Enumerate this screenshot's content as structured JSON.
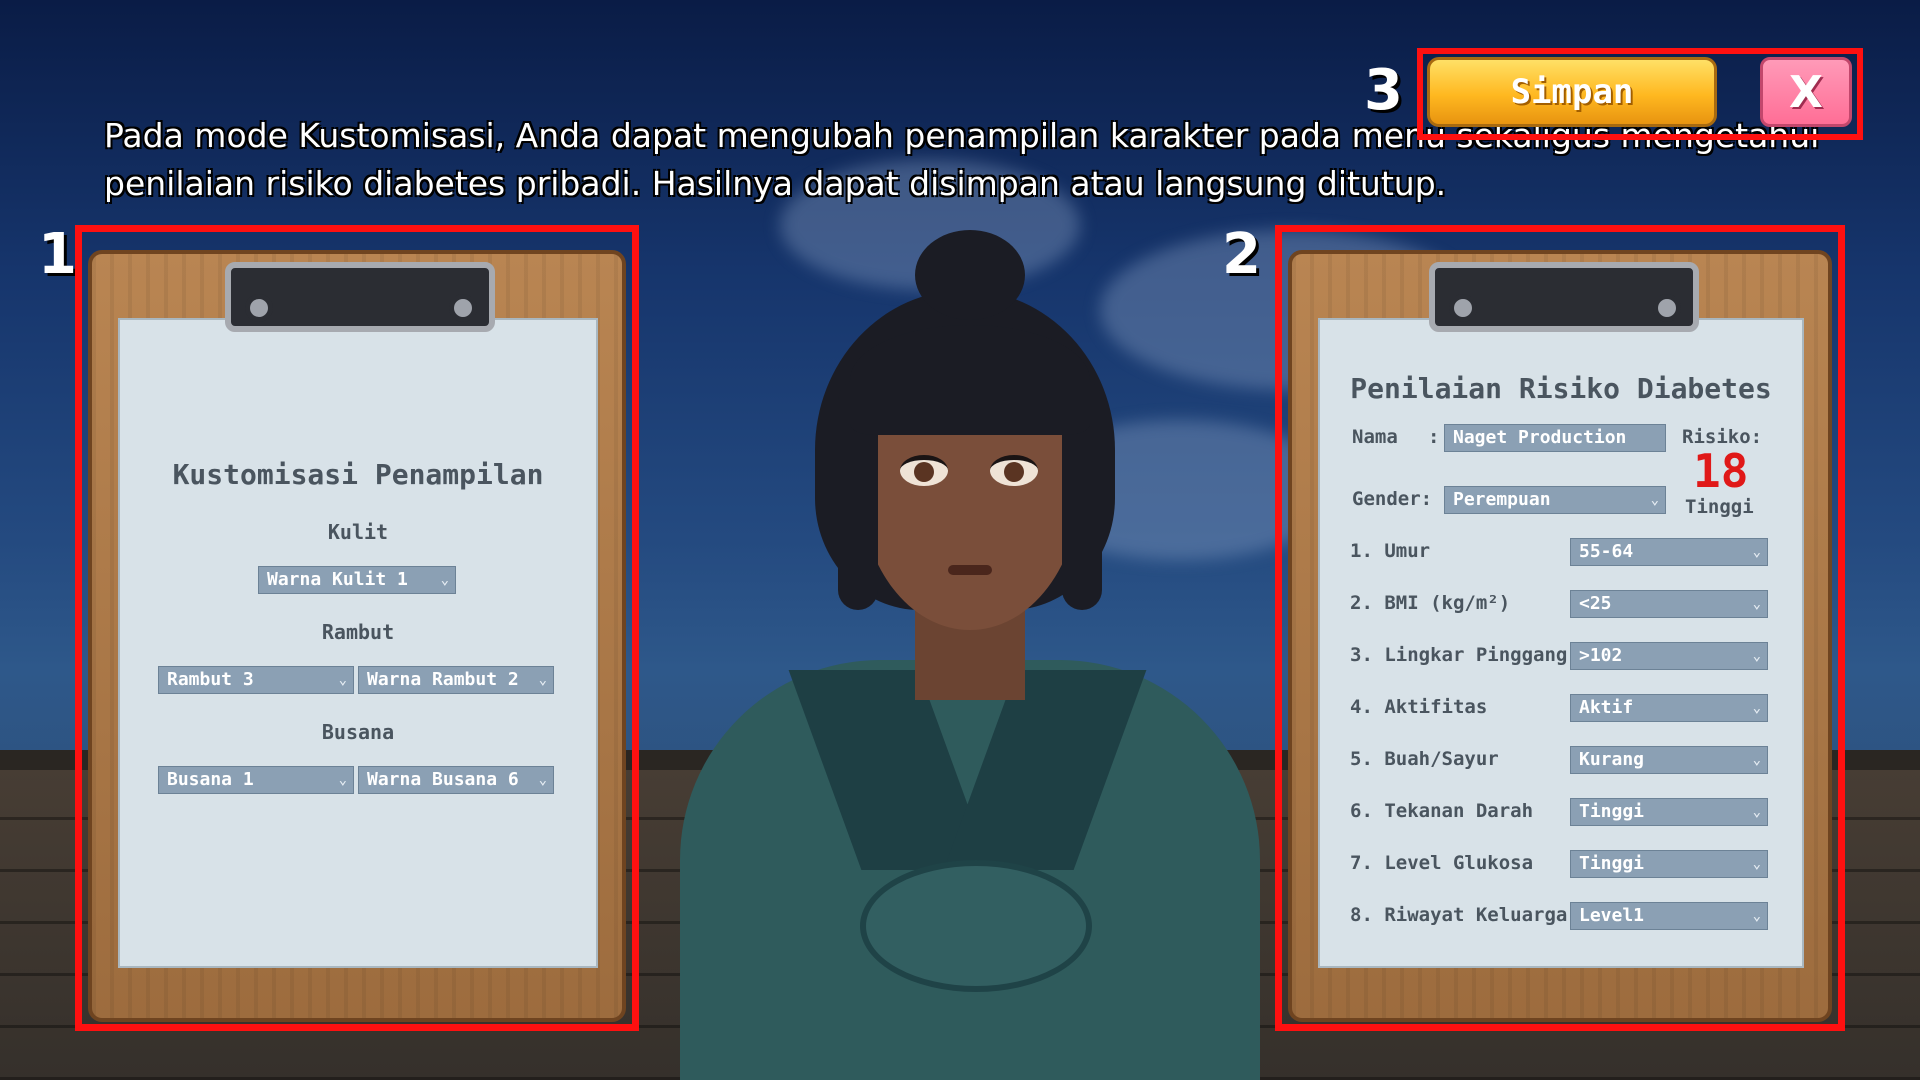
{
  "instruction": "Pada mode Kustomisasi, Anda dapat mengubah penampilan karakter pada menu sekaligus mengetahui penilaian risiko diabetes pribadi. Hasilnya dapat disimpan atau langsung ditutup.",
  "labels": {
    "one": "1",
    "two": "2",
    "three": "3"
  },
  "top_buttons": {
    "save_label": "Simpan",
    "close_label": "X"
  },
  "customization": {
    "title": "Kustomisasi Penampilan",
    "skin_label": "Kulit",
    "skin_value": "Warna Kulit 1",
    "hair_label": "Rambut",
    "hair_style": "Rambut 3",
    "hair_color": "Warna Rambut 2",
    "outfit_label": "Busana",
    "outfit_style": "Busana 1",
    "outfit_color": "Warna Busana 6"
  },
  "assessment": {
    "title": "Penilaian Risiko Diabetes",
    "name_label": "Nama",
    "name_colon": ":",
    "name_value": "Naget Production",
    "risk_label": "Risiko:",
    "risk_score": "18",
    "risk_level": "Tinggi",
    "gender_label": "Gender:",
    "gender_value": "Perempuan",
    "questions": [
      {
        "label": "1. Umur",
        "value": "55-64"
      },
      {
        "label": "2. BMI (kg/m²)",
        "value": "<25"
      },
      {
        "label": "3. Lingkar Pinggang",
        "value": ">102"
      },
      {
        "label": "4. Aktifitas",
        "value": "Aktif"
      },
      {
        "label": "5. Buah/Sayur",
        "value": "Kurang"
      },
      {
        "label": "6. Tekanan Darah",
        "value": "Tinggi"
      },
      {
        "label": "7. Level Glukosa",
        "value": "Tinggi"
      },
      {
        "label": "8. Riwayat Keluarga",
        "value": "Level1"
      }
    ]
  },
  "colors": {
    "highlight": "#ff1010",
    "risk": "#e01818",
    "save_button": "#ffb820",
    "close_button": "#ff6e96"
  },
  "icons": {
    "dropdown": "chevron-down-icon",
    "close": "close-icon"
  }
}
